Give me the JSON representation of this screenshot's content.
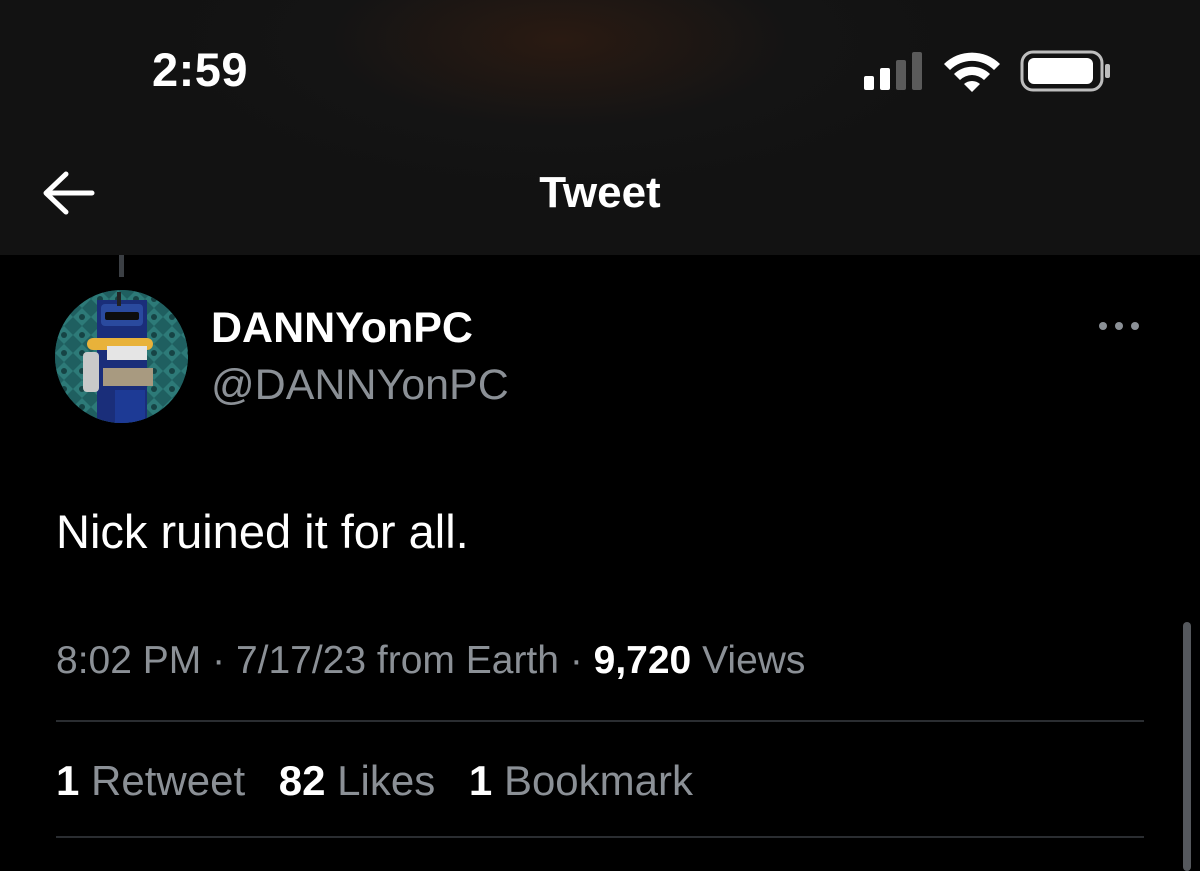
{
  "status_bar": {
    "time": "2:59",
    "icons": {
      "signal": "cellular-signal-icon",
      "wifi": "wifi-icon",
      "battery": "battery-icon"
    },
    "signal_bars_filled": 2,
    "signal_bars_total": 4,
    "battery_level": 0.95
  },
  "nav": {
    "back_icon": "back-arrow-icon",
    "title": "Tweet"
  },
  "tweet": {
    "author": {
      "display_name": "DANNYonPC",
      "handle": "@DANNYonPC"
    },
    "more_icon": "more-options-icon",
    "text": "Nick ruined it for all.",
    "meta": {
      "time": "8:02 PM",
      "separator": "·",
      "date": "7/17/23",
      "source": "from Earth",
      "views_count": "9,720",
      "views_label": "Views"
    },
    "stats": [
      {
        "count": "1",
        "label": "Retweet"
      },
      {
        "count": "82",
        "label": "Likes"
      },
      {
        "count": "1",
        "label": "Bookmark"
      }
    ]
  },
  "colors": {
    "background": "#000000",
    "header_background": "#121212",
    "primary_text": "#ffffff",
    "secondary_text": "#8b9096",
    "divider": "#2a2d31"
  }
}
